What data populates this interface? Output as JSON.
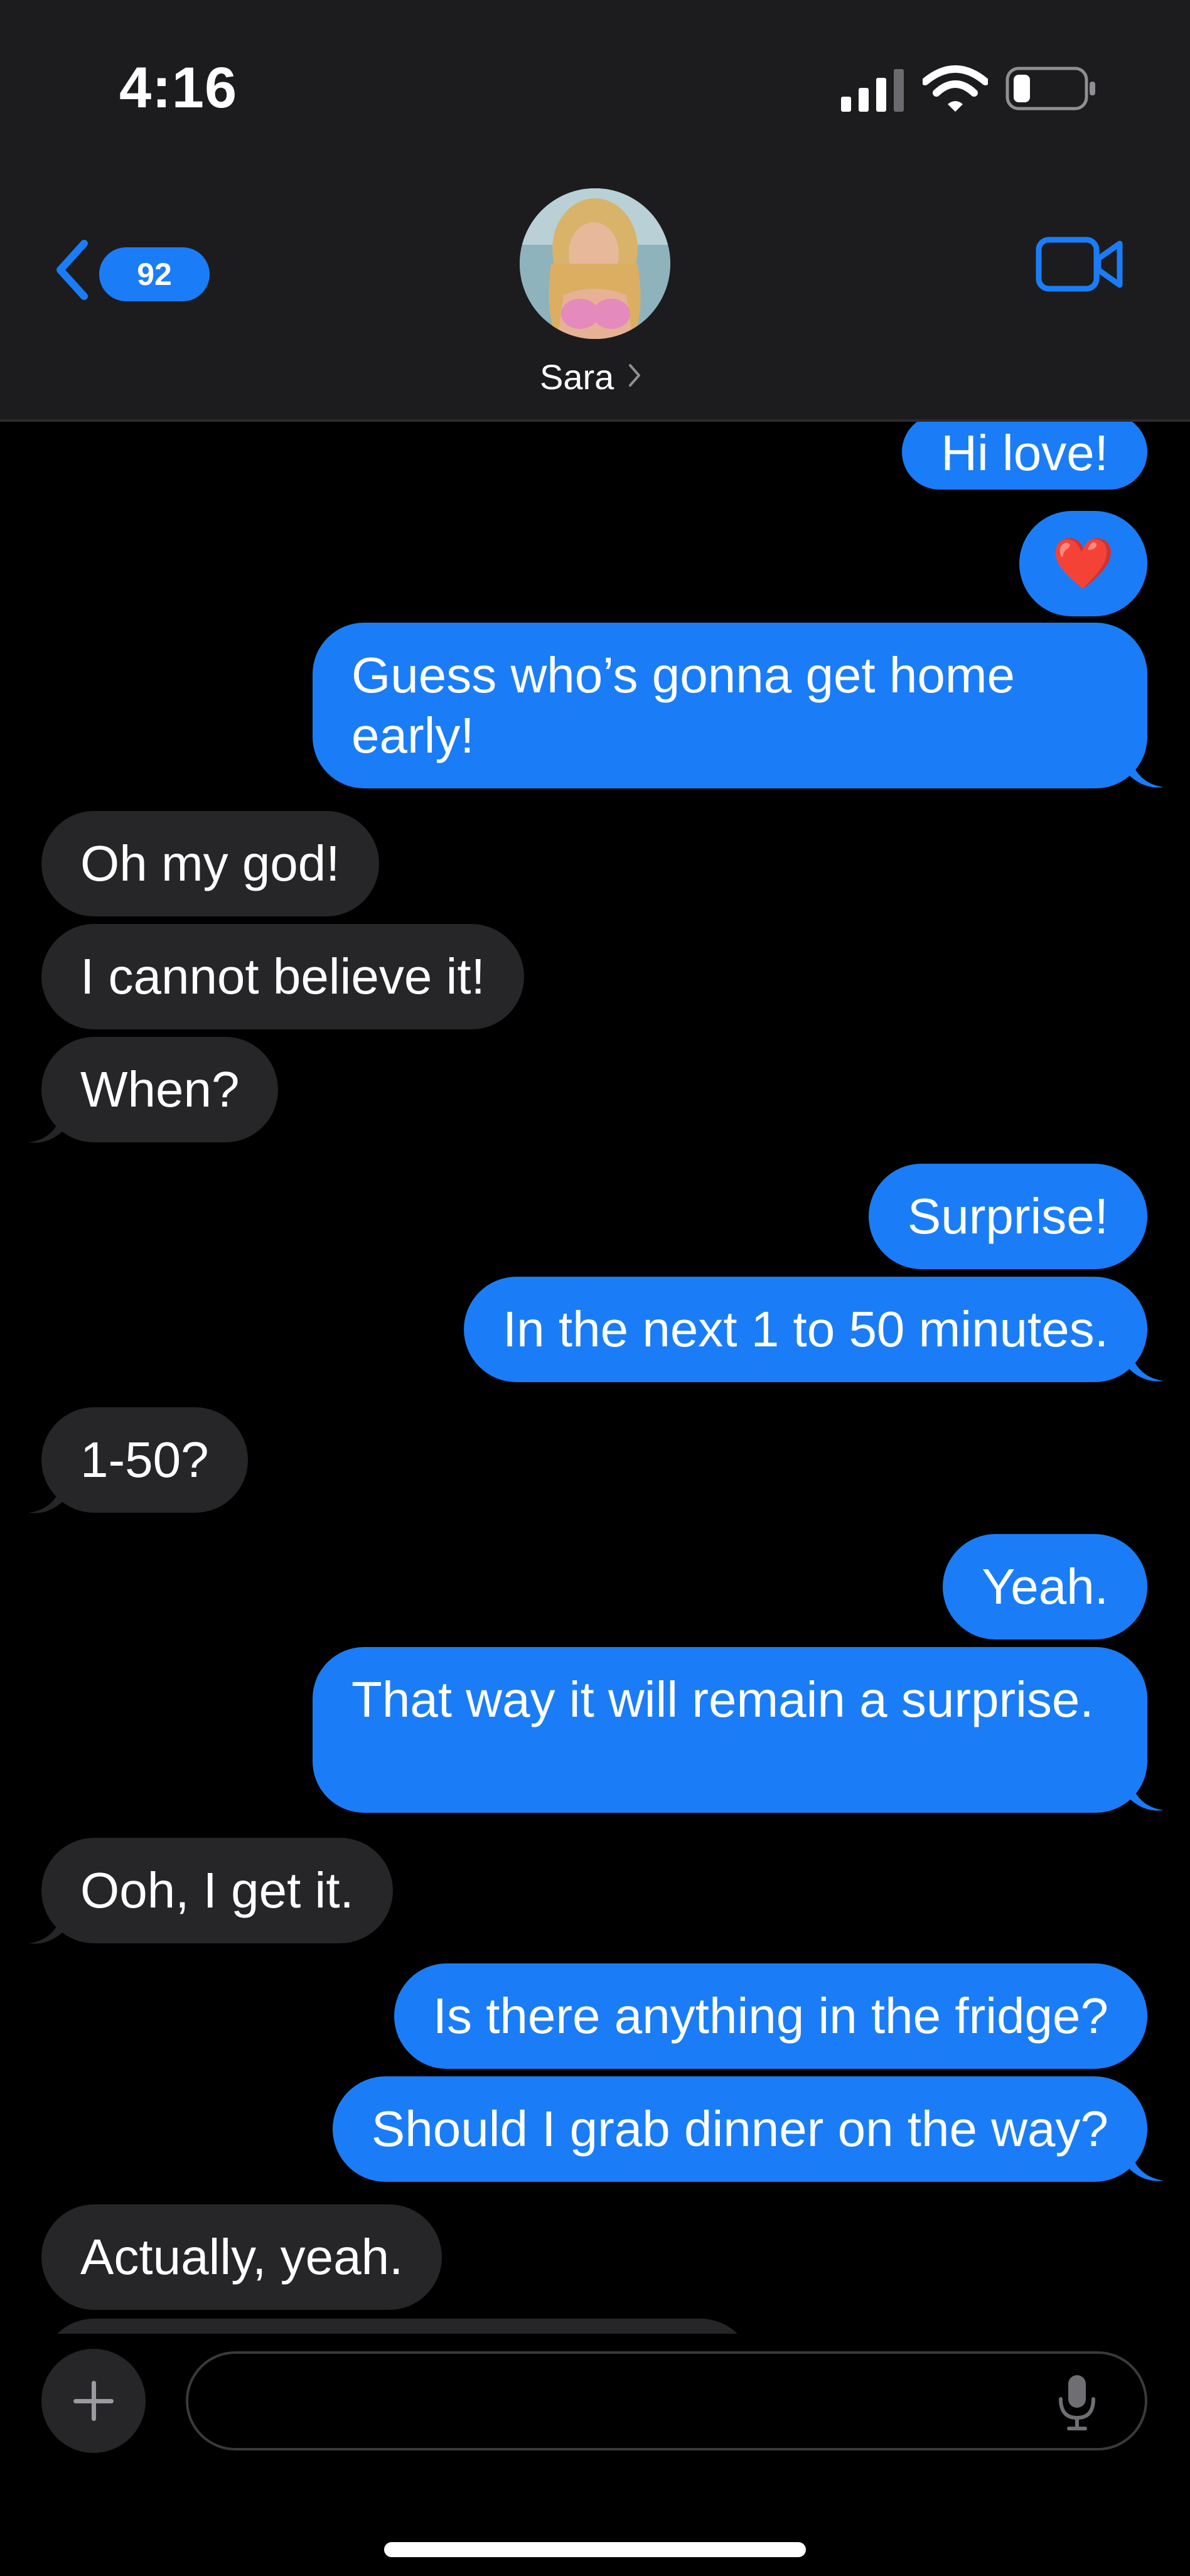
{
  "status_bar": {
    "time": "4:16",
    "battery_level": 0.25
  },
  "header": {
    "back_badge_count": "92",
    "contact_name": "Sara"
  },
  "colors": {
    "outgoing_bubble": "#1a7df7",
    "incoming_bubble": "#262628",
    "header_background": "#1c1c1e",
    "accent": "#1a7df7"
  },
  "messages": [
    {
      "direction": "outgoing",
      "text": "Hi love!"
    },
    {
      "direction": "outgoing",
      "text": "❤️"
    },
    {
      "direction": "outgoing",
      "text": "Guess who’s gonna get home early!"
    },
    {
      "direction": "incoming",
      "text": "Oh my god!"
    },
    {
      "direction": "incoming",
      "text": "I cannot believe it!"
    },
    {
      "direction": "incoming",
      "text": "When?"
    },
    {
      "direction": "outgoing",
      "text": "Surprise!"
    },
    {
      "direction": "outgoing",
      "text": "In the next 1 to 50 minutes."
    },
    {
      "direction": "incoming",
      "text": "1-50?"
    },
    {
      "direction": "outgoing",
      "text": "Yeah."
    },
    {
      "direction": "outgoing",
      "text": "That way it will remain a surprise."
    },
    {
      "direction": "incoming",
      "text": "Ooh, I get it."
    },
    {
      "direction": "outgoing",
      "text": "Is there anything in the fridge?"
    },
    {
      "direction": "outgoing",
      "text": "Should I grab dinner on the way?"
    },
    {
      "direction": "incoming",
      "text": "Actually, yeah."
    }
  ],
  "icons": {
    "back": "chevron-left-icon",
    "contact_chevron": "chevron-right-icon",
    "video_call": "video-camera-icon",
    "add": "plus-icon",
    "microphone": "microphone-icon",
    "signal": "cellular-signal-icon",
    "wifi": "wifi-icon",
    "battery": "battery-icon"
  }
}
